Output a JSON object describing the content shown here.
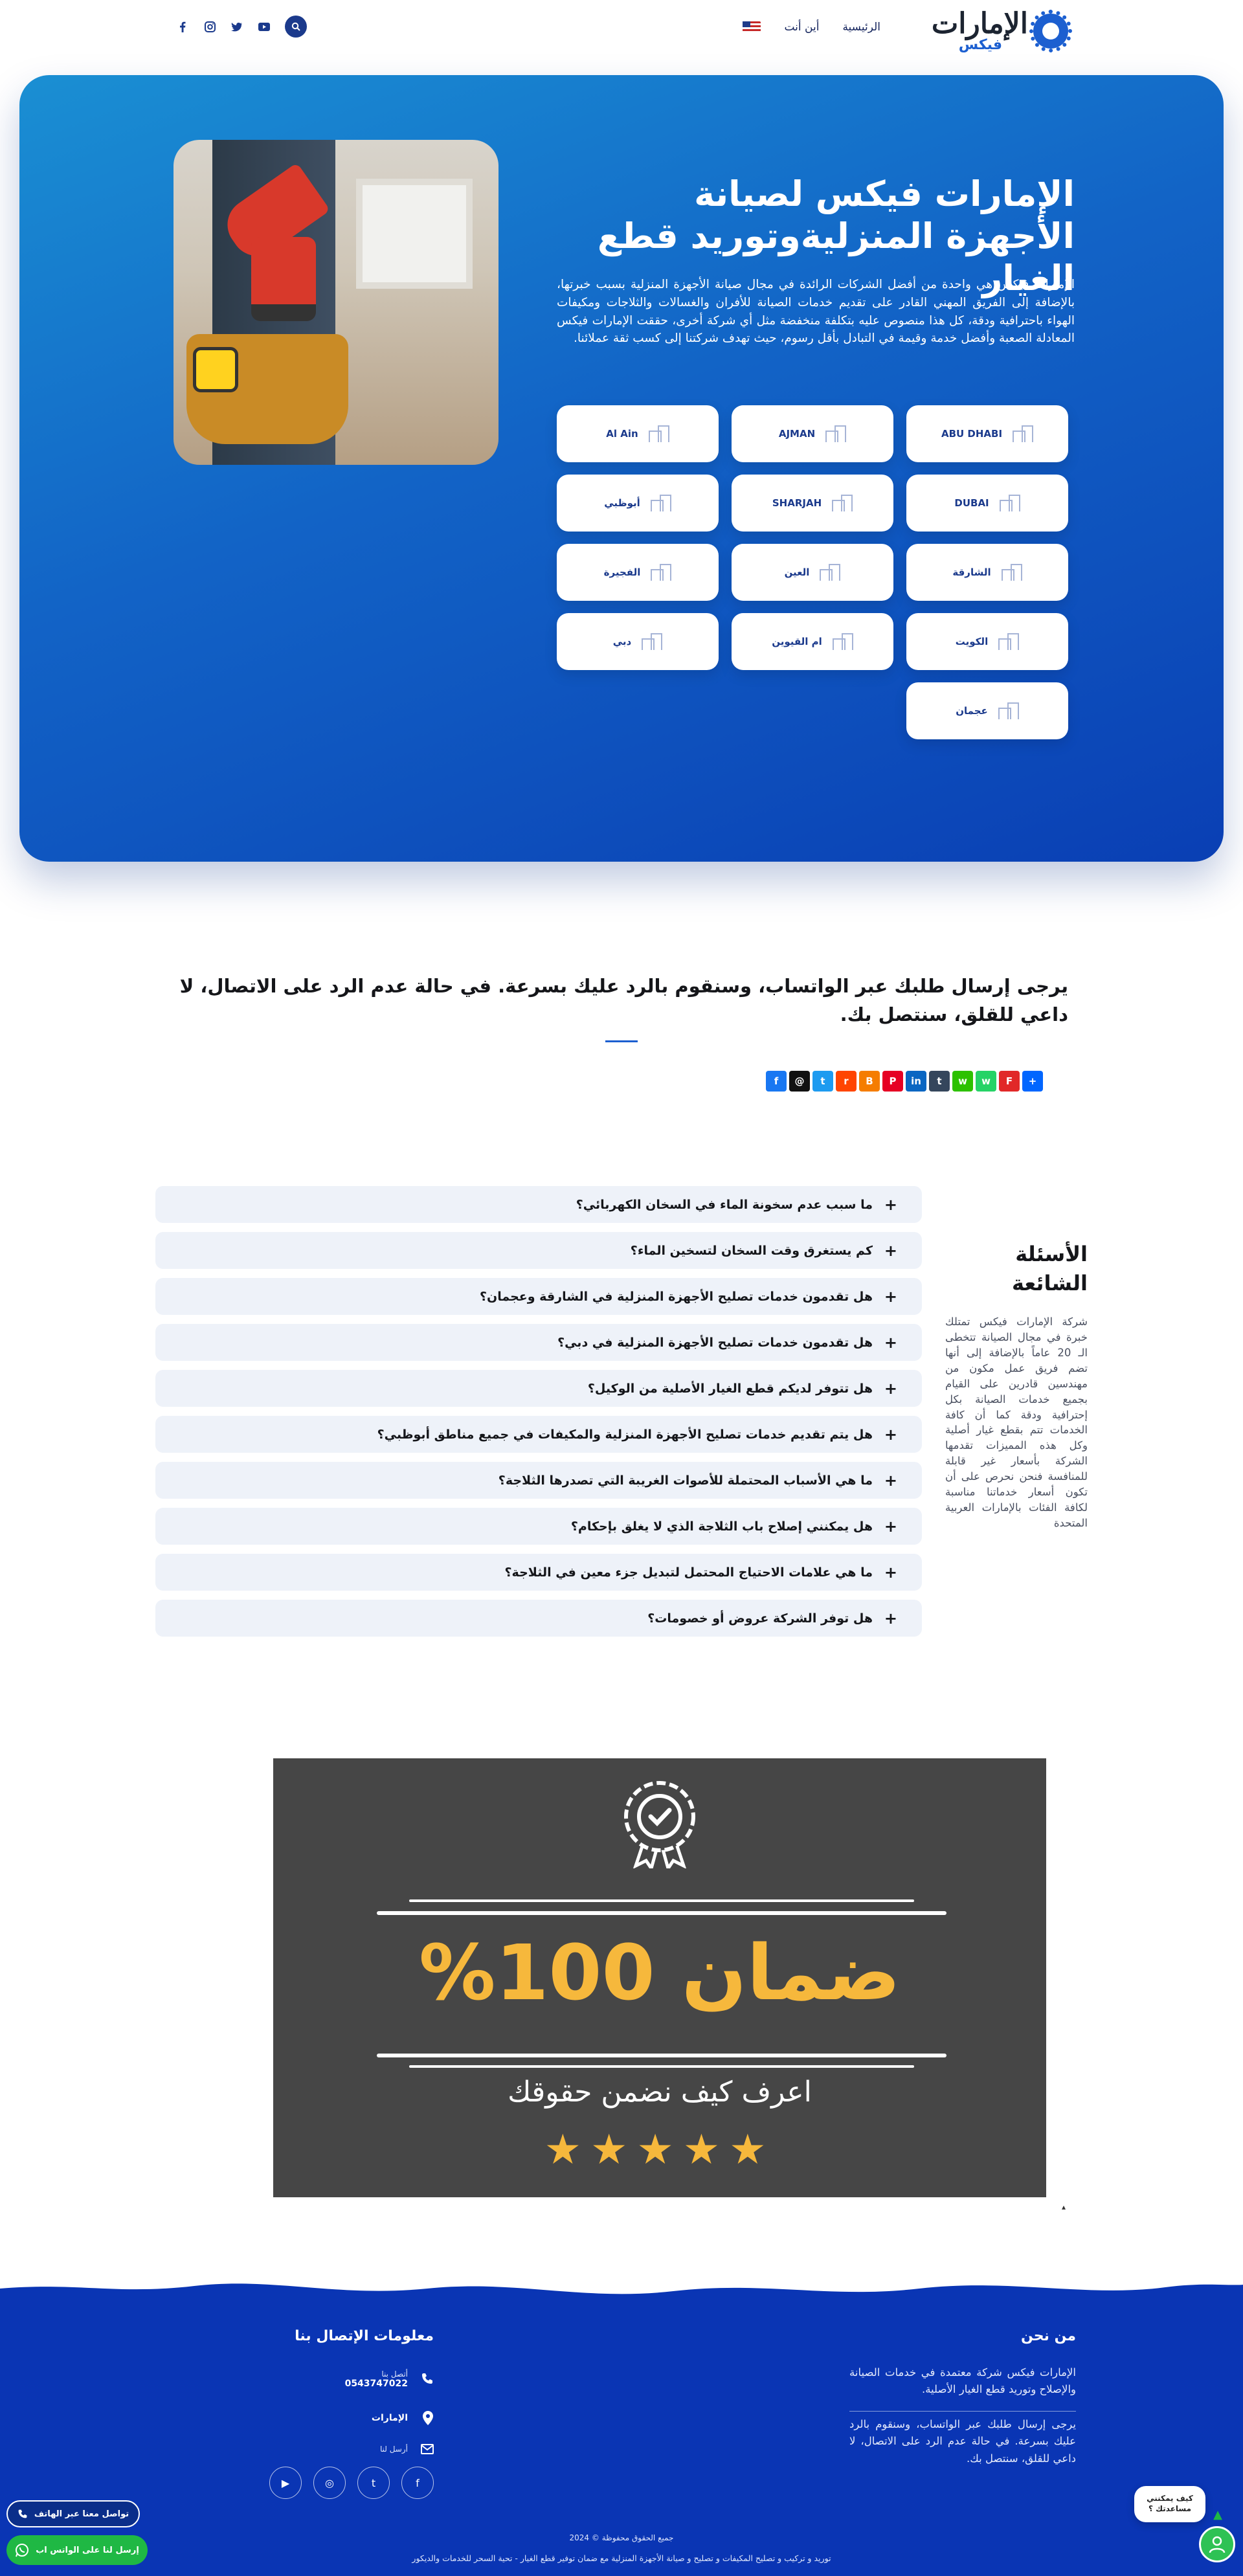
{
  "header": {
    "logo": {
      "line1": "الإمارات",
      "line2": "فيكس"
    },
    "nav": [
      {
        "label": "الرئيسية"
      },
      {
        "label": "أين أنت"
      }
    ],
    "socials": [
      "facebook-icon",
      "twitter-icon",
      "instagram-icon",
      "youtube-icon"
    ]
  },
  "hero": {
    "title": "الإمارات فيكس لصيانة الأجهزة المنزليةوتوريد قطع الغيار",
    "description": "الإمارات فيكس هي واحدة من أفضل الشركات الرائدة في مجال صيانة الأجهزة المنزلية بسبب خبرتها، بالإضافة إلى الفريق المهني القادر على تقديم خدمات الصيانة للأفران والغسالات والثلاجات ومكيفات الهواء باحترافية ودقة، كل هذا منصوص عليه بتكلفة منخفضة مثل أي شركة أخرى، حققت الإمارات فيكس المعادلة الصعبة وأفضل خدمة وقيمة في التبادل بأقل رسوم، حيث تهدف شركتنا إلى كسب ثقة عملائنا.",
    "cities": [
      {
        "label": "ABU DHABI"
      },
      {
        "label": "AJMAN"
      },
      {
        "label": "Al Ain"
      },
      {
        "label": "DUBAI"
      },
      {
        "label": "SHARJAH"
      },
      {
        "label": "أبوظبي"
      },
      {
        "label": "الشارقة"
      },
      {
        "label": "العين"
      },
      {
        "label": "الفجيرة"
      },
      {
        "label": "الكويت"
      },
      {
        "label": "ام القيوين"
      },
      {
        "label": "دبي"
      },
      {
        "label": "عجمان"
      }
    ]
  },
  "notice": {
    "text": "يرجى إرسال طلبك عبر الواتساب، وسنقوم بالرد عليك بسرعة. في حالة عدم الرد على الاتصال، لا داعي للقلق، سنتصل بك."
  },
  "share": [
    {
      "icon": "facebook-icon",
      "glyph": "f",
      "color": "#1877f2"
    },
    {
      "icon": "threads-icon",
      "glyph": "@",
      "color": "#111111"
    },
    {
      "icon": "twitter-icon",
      "glyph": "t",
      "color": "#1d9bf0"
    },
    {
      "icon": "reddit-icon",
      "glyph": "r",
      "color": "#ff4500"
    },
    {
      "icon": "blogger-icon",
      "glyph": "B",
      "color": "#f57d00"
    },
    {
      "icon": "pinterest-icon",
      "glyph": "P",
      "color": "#e60023"
    },
    {
      "icon": "linkedin-icon",
      "glyph": "in",
      "color": "#0a66c2"
    },
    {
      "icon": "tumblr-icon",
      "glyph": "t",
      "color": "#35465c"
    },
    {
      "icon": "wechat-icon",
      "glyph": "w",
      "color": "#2dc100"
    },
    {
      "icon": "whatsapp-icon",
      "glyph": "w",
      "color": "#25d366"
    },
    {
      "icon": "flipboard-icon",
      "glyph": "F",
      "color": "#e12828"
    },
    {
      "icon": "share-plus-icon",
      "glyph": "+",
      "color": "#0166ff"
    }
  ],
  "faq": {
    "title": "الأسئلة الشائعة",
    "about": "شركة الإمارات فيكس تمتلك خبرة في مجال الصيانة تتخطى الـ 20 عاماً بالإضافة إلى أنها تضم فريق عمل مكون من مهندسين قادرين على القيام بجميع خدمات الصيانة بكل إحترافية ودقة كما أن كافة الخدمات تتم بقطع غيار أصلية وكل هذه المميزات تقدمها الشركة بأسعار غير قابلة للمنافسة فنحن نحرص على أن تكون أسعار خدماتنا مناسبة لكافة الفئات بالإمارات العربية المتحدة",
    "items": [
      {
        "q": "ما سبب عدم سخونة الماء في السخان الكهربائي؟"
      },
      {
        "q": "كم يستغرق وقت السخان لتسخين الماء؟"
      },
      {
        "q": "هل تقدمون خدمات تصليح الأجهزة المنزلية في الشارقة وعجمان؟"
      },
      {
        "q": "هل تقدمون خدمات تصليح الأجهزة المنزلية في دبي؟"
      },
      {
        "q": "هل تتوفر لديكم قطع الغيار الأصلية من الوكيل؟"
      },
      {
        "q": "هل يتم تقديم خدمات تصليح الأجهزة المنزلية والمكيفات في جميع مناطق أبوظبي؟"
      },
      {
        "q": "ما هي الأسباب المحتملة للأصوات الغريبة التي تصدرها الثلاجة؟"
      },
      {
        "q": "هل يمكنني إصلاح باب الثلاجة الذي لا يغلق بإحكام؟"
      },
      {
        "q": "ما هي علامات الاحتياج المحتمل لتبديل جزء معين في الثلاجة؟"
      },
      {
        "q": "هل توفر الشركة عروض أو خصومات؟"
      }
    ]
  },
  "guarantee": {
    "title": "ضمان 100%",
    "subtitle": "اعرف كيف نضمن حقوقك",
    "stars": "★★★★★"
  },
  "footer": {
    "about_title": "من نحن",
    "about_text": "الإمارات فيكس شركة معتمدة في خدمات الصيانة والإصلاح وتوريد قطع الغيار الأصلية.",
    "about_text2": "يرجى إرسال طلبك عبر الواتساب، وسنقوم بالرد عليك بسرعة. في حالة عدم الرد على الاتصال، لا داعي للقلق، سنتصل بك.",
    "contact_title": "معلومات الإتصال بنا",
    "phone_label": "أتصل بنا",
    "phone": "0543747022",
    "location": "الإمارات",
    "email_label": "أرسل لنا",
    "copyright": "جميع الحقوق محفوظة © 2024",
    "seo": "توريد و تركيب و تصليح المكيفات و تصليح و صيانة الأجهزة المنزلية مع ضمان توفير قطع الغيار - تحية السحر للخدمات والديكور"
  },
  "floating": {
    "call": "تواصل معنا عبر الهاتف",
    "whatsapp": "إرسل لنا على الواتس اب",
    "help": "كيف يمكنني مساعدتك ؟"
  },
  "colors": {
    "brand": "#1c5fd0",
    "hero_start": "#1a8fd3",
    "hero_end": "#0a3fb4",
    "footer": "#0a35b4",
    "gold": "#f6b83c",
    "whatsapp": "#1fb844"
  }
}
